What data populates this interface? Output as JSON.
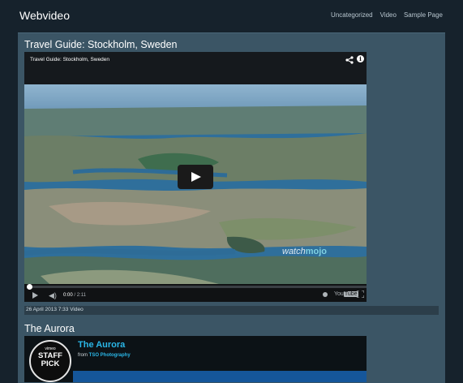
{
  "site": {
    "title": "Webvideo",
    "nav": [
      "Uncategorized",
      "Video",
      "Sample Page"
    ]
  },
  "posts": [
    {
      "title": "Travel Guide: Stockholm, Sweden",
      "video": {
        "title": "Travel Guide: Stockholm, Sweden",
        "current_time": "0:00",
        "duration": "2:11",
        "progress": 0,
        "watermark_prefix": "watch",
        "watermark_brand": "mojo",
        "provider": "You",
        "provider_tag": "Tube"
      },
      "meta": "26 April 2013 7:33 Video"
    },
    {
      "title": "The Aurora",
      "embed": {
        "badge_line1": "vimeo",
        "badge_line2": "STAFF",
        "badge_line3": "PICK",
        "title": "The Aurora",
        "from_prefix": "from",
        "author": "TSO Photography"
      }
    }
  ]
}
